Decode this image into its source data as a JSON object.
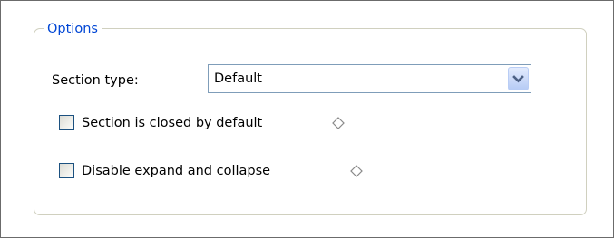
{
  "options": {
    "legend": "Options",
    "section_type": {
      "label": "Section type:",
      "value": "Default"
    },
    "closed_by_default": {
      "label": "Section is closed by default",
      "checked": false,
      "hint_icon": "diamond-icon"
    },
    "disable_expand": {
      "label": "Disable expand and collapse",
      "checked": false,
      "hint_icon": "diamond-icon"
    }
  },
  "colors": {
    "legend": "#0046d5",
    "group_border": "#d0d0bf",
    "input_border": "#7f9db9",
    "checkbox_border": "#1c5180",
    "dropdown_arrow": "#4d6185"
  }
}
